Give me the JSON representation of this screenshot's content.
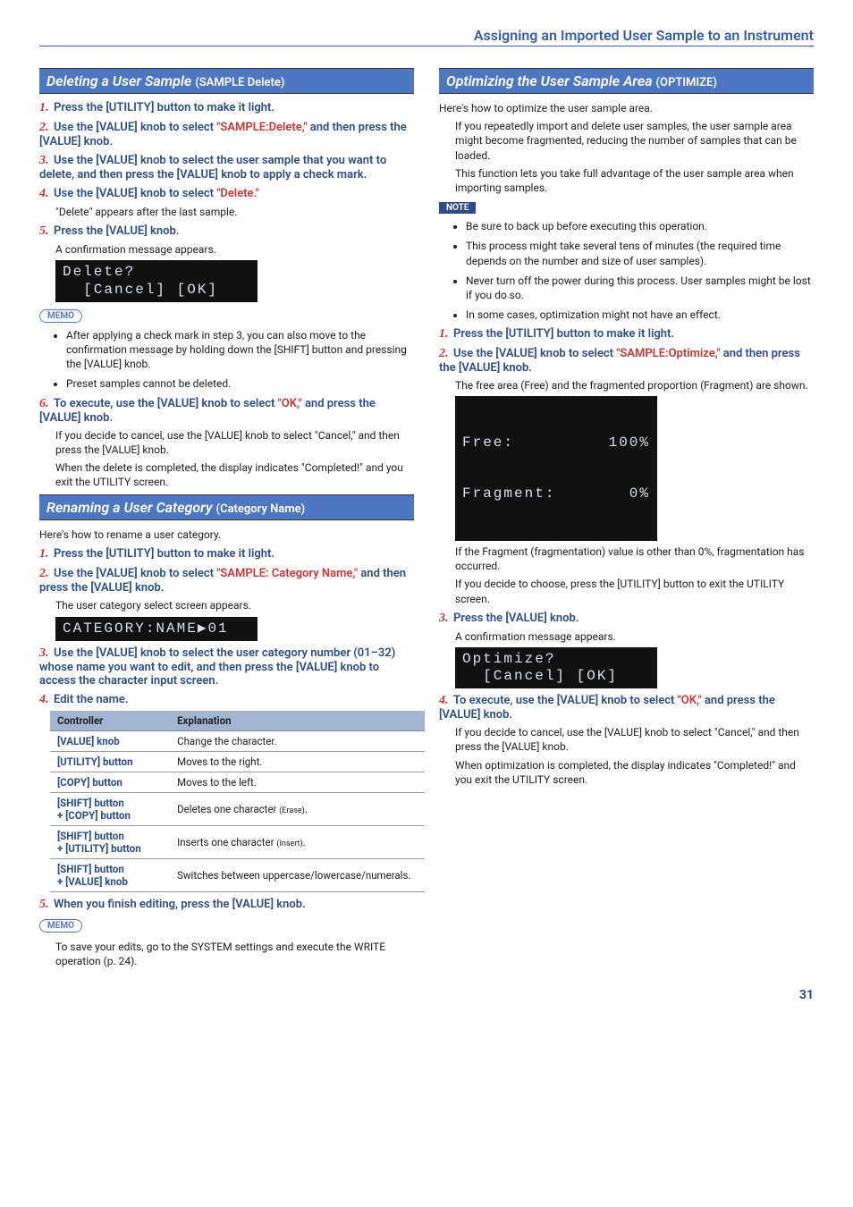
{
  "header": "Assigning an Imported User Sample to an Instrument",
  "pagenum": "31",
  "left": {
    "section1_title": "Deleting a User Sample ",
    "section1_sub": "(SAMPLE Delete)",
    "s1_step1": "Press the [UTILITY] button to make it light.",
    "s1_step2a": "Use the [VALUE] knob to select ",
    "s1_step2b": "\"SAMPLE:Delete,\"",
    "s1_step2c": " and then press the [VALUE] knob.",
    "s1_step3": "Use the [VALUE] knob to select the user sample that you want to delete, and then press the [VALUE] knob to apply a check mark.",
    "s1_step4a": "Use the [VALUE] knob to select ",
    "s1_step4b": "\"Delete.\"",
    "s1_step4_body": "\"Delete\" appears after the last sample.",
    "s1_step5": "Press the [VALUE] knob.",
    "s1_step5_body": "A confirmation message appears.",
    "lcd1": "Delete?\n  [Cancel] [OK]",
    "memo1_b1": "After applying a check mark in step 3, you can also move to the confirmation message by holding down the [SHIFT] button and pressing the [VALUE] knob.",
    "memo1_b2": "Preset samples cannot be deleted.",
    "s1_step6a": "To execute, use the [VALUE] knob to select ",
    "s1_step6b": "\"OK,\"",
    "s1_step6c": " and press the [VALUE] knob.",
    "s1_step6_body1": "If you decide to cancel, use the [VALUE] knob to select \"Cancel,\" and then press the [VALUE] knob.",
    "s1_step6_body2": "When the delete is completed, the display indicates \"Completed!\" and you exit the UTILITY screen.",
    "section2_title": "Renaming a User Category ",
    "section2_sub": "(Category Name)",
    "s2_intro": "Here's how to rename a user category.",
    "s2_step1": "Press the [UTILITY] button to make it light.",
    "s2_step2a": "Use the [VALUE] knob to select ",
    "s2_step2b": "\"SAMPLE: Category Name,\"",
    "s2_step2c": " and then press the [VALUE] knob.",
    "s2_step2_body": "The user category select screen appears.",
    "lcd2": "CATEGORY:NAME▶01",
    "s2_step3": "Use the [VALUE] knob to select the user category number (01–32) whose name you want to edit, and then press the [VALUE] knob to access the character input screen.",
    "s2_step4": "Edit the name.",
    "table": {
      "hdr1": "Controller",
      "hdr2": "Explanation",
      "rows": [
        {
          "c": "[VALUE] knob",
          "e": "Change the character."
        },
        {
          "c": "[UTILITY] button",
          "e": "Moves to the right."
        },
        {
          "c": "[COPY] button",
          "e": "Moves to the left."
        },
        {
          "c": "[SHIFT] button\n+ [COPY] button",
          "e": "Deletes one character <span class='small'>(Erase)</span>."
        },
        {
          "c": "[SHIFT] button\n+ [UTILITY] button",
          "e": "Inserts one character <span class='small'>(Insert)</span>."
        },
        {
          "c": "[SHIFT] button\n+ [VALUE] knob",
          "e": "Switches between uppercase/lowercase/numerals."
        }
      ]
    },
    "s2_step5": "When you finish editing, press the [VALUE] knob.",
    "memo2_b1": "To save your edits, go to the SYSTEM settings and execute the WRITE operation (p. 24)."
  },
  "right": {
    "section3_title": "Optimizing the User Sample Area ",
    "section3_sub": "(OPTIMIZE)",
    "s3_intro": "Here's how to optimize the user sample area.",
    "s3_body1": "If you repeatedly import and delete user samples, the user sample area might become fragmented, reducing the number of samples that can be loaded.",
    "s3_body2": "This function lets you take full advantage of the user sample area when importing samples.",
    "note_b1": "Be sure to back up before executing this operation.",
    "note_b2": "This process might take several tens of minutes (the required time depends on the number and size of user samples).",
    "note_b3": "Never turn off the power during this process. User samples might be lost if you do so.",
    "note_b4": "In some cases, optimization might not have an effect.",
    "s3_step1": "Press the [UTILITY] button to make it light.",
    "s3_step2a": "Use the [VALUE] knob to select ",
    "s3_step2b": "\"SAMPLE:Optimize,\"",
    "s3_step2c": " and then press the [VALUE] knob.",
    "s3_step2_body": "The free area (Free) and the fragmented proportion (Fragment) are shown.",
    "lcd3_l1a": "Free:",
    "lcd3_l1b": "100%",
    "lcd3_l2a": "Fragment:",
    "lcd3_l2b": "0%",
    "s3_body3": "If the Fragment (fragmentation) value is other than 0%, fragmentation has occurred.",
    "s3_body4": "If you decide to choose, press the [UTILITY] button to exit the UTILITY screen.",
    "s3_step3": "Press the [VALUE] knob.",
    "s3_step3_body": "A confirmation message appears.",
    "lcd4": "Optimize?\n  [Cancel] [OK]",
    "s3_step4a": "To execute, use the [VALUE] knob to select ",
    "s3_step4b": "\"OK,\"",
    "s3_step4c": " and press the [VALUE] knob.",
    "s3_step4_body1": "If you decide to cancel, use the [VALUE] knob to select \"Cancel,\" and then press the [VALUE] knob.",
    "s3_step4_body2": "When optimization is completed, the display indicates \"Completed!\" and you exit the UTILITY screen."
  },
  "labels": {
    "memo": "MEMO",
    "note": "NOTE"
  }
}
